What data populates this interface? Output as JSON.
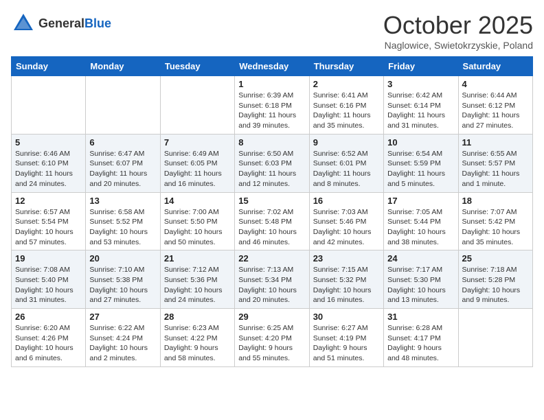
{
  "logo": {
    "text_general": "General",
    "text_blue": "Blue"
  },
  "title": "October 2025",
  "subtitle": "Naglowice, Swietokrzyskie, Poland",
  "days_of_week": [
    "Sunday",
    "Monday",
    "Tuesday",
    "Wednesday",
    "Thursday",
    "Friday",
    "Saturday"
  ],
  "weeks": [
    [
      {
        "day": "",
        "info": ""
      },
      {
        "day": "",
        "info": ""
      },
      {
        "day": "",
        "info": ""
      },
      {
        "day": "1",
        "info": "Sunrise: 6:39 AM\nSunset: 6:18 PM\nDaylight: 11 hours\nand 39 minutes."
      },
      {
        "day": "2",
        "info": "Sunrise: 6:41 AM\nSunset: 6:16 PM\nDaylight: 11 hours\nand 35 minutes."
      },
      {
        "day": "3",
        "info": "Sunrise: 6:42 AM\nSunset: 6:14 PM\nDaylight: 11 hours\nand 31 minutes."
      },
      {
        "day": "4",
        "info": "Sunrise: 6:44 AM\nSunset: 6:12 PM\nDaylight: 11 hours\nand 27 minutes."
      }
    ],
    [
      {
        "day": "5",
        "info": "Sunrise: 6:46 AM\nSunset: 6:10 PM\nDaylight: 11 hours\nand 24 minutes."
      },
      {
        "day": "6",
        "info": "Sunrise: 6:47 AM\nSunset: 6:07 PM\nDaylight: 11 hours\nand 20 minutes."
      },
      {
        "day": "7",
        "info": "Sunrise: 6:49 AM\nSunset: 6:05 PM\nDaylight: 11 hours\nand 16 minutes."
      },
      {
        "day": "8",
        "info": "Sunrise: 6:50 AM\nSunset: 6:03 PM\nDaylight: 11 hours\nand 12 minutes."
      },
      {
        "day": "9",
        "info": "Sunrise: 6:52 AM\nSunset: 6:01 PM\nDaylight: 11 hours\nand 8 minutes."
      },
      {
        "day": "10",
        "info": "Sunrise: 6:54 AM\nSunset: 5:59 PM\nDaylight: 11 hours\nand 5 minutes."
      },
      {
        "day": "11",
        "info": "Sunrise: 6:55 AM\nSunset: 5:57 PM\nDaylight: 11 hours\nand 1 minute."
      }
    ],
    [
      {
        "day": "12",
        "info": "Sunrise: 6:57 AM\nSunset: 5:54 PM\nDaylight: 10 hours\nand 57 minutes."
      },
      {
        "day": "13",
        "info": "Sunrise: 6:58 AM\nSunset: 5:52 PM\nDaylight: 10 hours\nand 53 minutes."
      },
      {
        "day": "14",
        "info": "Sunrise: 7:00 AM\nSunset: 5:50 PM\nDaylight: 10 hours\nand 50 minutes."
      },
      {
        "day": "15",
        "info": "Sunrise: 7:02 AM\nSunset: 5:48 PM\nDaylight: 10 hours\nand 46 minutes."
      },
      {
        "day": "16",
        "info": "Sunrise: 7:03 AM\nSunset: 5:46 PM\nDaylight: 10 hours\nand 42 minutes."
      },
      {
        "day": "17",
        "info": "Sunrise: 7:05 AM\nSunset: 5:44 PM\nDaylight: 10 hours\nand 38 minutes."
      },
      {
        "day": "18",
        "info": "Sunrise: 7:07 AM\nSunset: 5:42 PM\nDaylight: 10 hours\nand 35 minutes."
      }
    ],
    [
      {
        "day": "19",
        "info": "Sunrise: 7:08 AM\nSunset: 5:40 PM\nDaylight: 10 hours\nand 31 minutes."
      },
      {
        "day": "20",
        "info": "Sunrise: 7:10 AM\nSunset: 5:38 PM\nDaylight: 10 hours\nand 27 minutes."
      },
      {
        "day": "21",
        "info": "Sunrise: 7:12 AM\nSunset: 5:36 PM\nDaylight: 10 hours\nand 24 minutes."
      },
      {
        "day": "22",
        "info": "Sunrise: 7:13 AM\nSunset: 5:34 PM\nDaylight: 10 hours\nand 20 minutes."
      },
      {
        "day": "23",
        "info": "Sunrise: 7:15 AM\nSunset: 5:32 PM\nDaylight: 10 hours\nand 16 minutes."
      },
      {
        "day": "24",
        "info": "Sunrise: 7:17 AM\nSunset: 5:30 PM\nDaylight: 10 hours\nand 13 minutes."
      },
      {
        "day": "25",
        "info": "Sunrise: 7:18 AM\nSunset: 5:28 PM\nDaylight: 10 hours\nand 9 minutes."
      }
    ],
    [
      {
        "day": "26",
        "info": "Sunrise: 6:20 AM\nSunset: 4:26 PM\nDaylight: 10 hours\nand 6 minutes."
      },
      {
        "day": "27",
        "info": "Sunrise: 6:22 AM\nSunset: 4:24 PM\nDaylight: 10 hours\nand 2 minutes."
      },
      {
        "day": "28",
        "info": "Sunrise: 6:23 AM\nSunset: 4:22 PM\nDaylight: 9 hours\nand 58 minutes."
      },
      {
        "day": "29",
        "info": "Sunrise: 6:25 AM\nSunset: 4:20 PM\nDaylight: 9 hours\nand 55 minutes."
      },
      {
        "day": "30",
        "info": "Sunrise: 6:27 AM\nSunset: 4:19 PM\nDaylight: 9 hours\nand 51 minutes."
      },
      {
        "day": "31",
        "info": "Sunrise: 6:28 AM\nSunset: 4:17 PM\nDaylight: 9 hours\nand 48 minutes."
      },
      {
        "day": "",
        "info": ""
      }
    ]
  ]
}
